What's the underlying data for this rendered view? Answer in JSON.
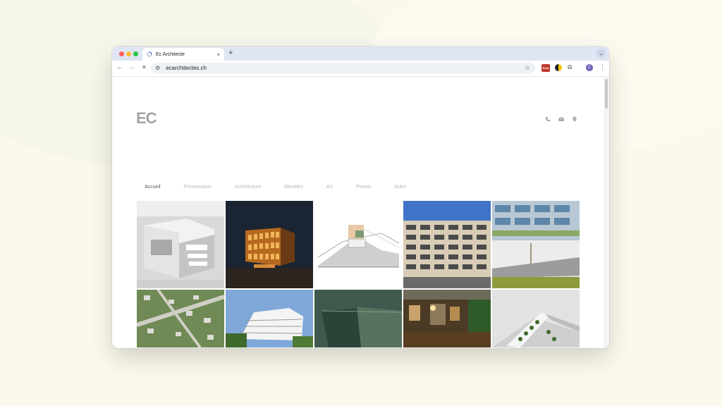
{
  "browser": {
    "tab_title": "Ec Architecte",
    "tab_close": "×",
    "new_tab": "+",
    "tab_menu": "⌄",
    "back": "←",
    "forward": "→",
    "stop": "✕",
    "url": "ecarchitectes.ch",
    "star": "☆",
    "extension_badge": "Beta",
    "extensions_icon": "⧉",
    "profile_initial": "C",
    "menu": "⋮"
  },
  "site": {
    "logo": "EC",
    "nav": [
      {
        "label": "Accueil",
        "active": true
      },
      {
        "label": "Présentation",
        "active": false
      },
      {
        "label": "Architecture",
        "active": false
      },
      {
        "label": "Meubles",
        "active": false
      },
      {
        "label": "Art",
        "active": false
      },
      {
        "label": "Photos",
        "active": false
      },
      {
        "label": "Autre",
        "active": false
      }
    ],
    "contact_icons": [
      "phone-icon",
      "mail-icon",
      "location-icon"
    ]
  },
  "colors": {
    "traffic_red": "#ff5f57",
    "traffic_yellow": "#febc2e",
    "traffic_green": "#28c840",
    "logo": "#a3a3a3",
    "nav_active": "#555555",
    "nav_inactive": "#b7b7b7"
  }
}
